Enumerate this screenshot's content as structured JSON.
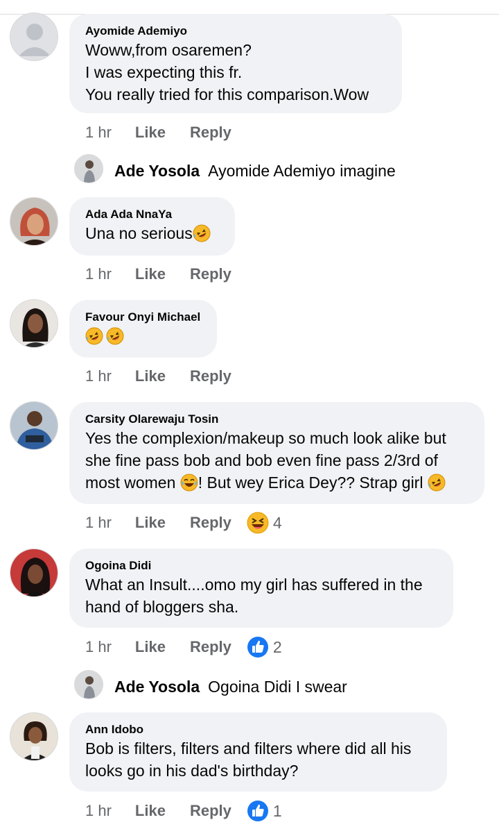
{
  "colors": {
    "bubble": "#f0f2f5",
    "meta": "#65676b",
    "like_blue": "#1877f2",
    "haha_yellow": "#f7b928"
  },
  "comments": [
    {
      "author": "Ayomide Ademiyo",
      "text": "Woww,from osaremen?\nI was expecting this fr.\nYou really tried for this comparison.Wow",
      "time": "1 hr",
      "like": "Like",
      "reply": "Reply",
      "avatar_icon": "default-user-avatar-icon"
    },
    {
      "author": "Ada Ada NnaYa",
      "text": "Una no serious",
      "time": "1 hr",
      "like": "Like",
      "reply": "Reply",
      "avatar_icon": "user-photo-avatar"
    },
    {
      "author": "Favour Onyi Michael",
      "text": "",
      "time": "1 hr",
      "like": "Like",
      "reply": "Reply",
      "avatar_icon": "user-photo-avatar"
    },
    {
      "author": "Carsity Olarewaju Tosin",
      "line1": "Yes the complexion/makeup so much look alike but",
      "line2": "she fine pass bob and bob even fine pass 2/3rd of",
      "line3a": "most women ",
      "line3b": "! But wey Erica Dey?? Strap girl ",
      "time": "1 hr",
      "like": "Like",
      "reply": "Reply",
      "reaction_icon": "haha-reaction-icon",
      "reaction_count": "4"
    },
    {
      "author": "Ogoina Didi",
      "text": "What an Insult....omo my girl has suffered in the\nhand of bloggers sha.",
      "time": "1 hr",
      "like": "Like",
      "reply": "Reply",
      "reaction_icon": "like-reaction-icon",
      "reaction_count": "2"
    },
    {
      "author": "Ann Idobo",
      "text": "Bob is filters, filters and filters where did all his\nlooks go in his dad's birthday?",
      "time": "1 hr",
      "like": "Like",
      "reply": "Reply",
      "reaction_icon": "like-reaction-icon",
      "reaction_count": "1"
    }
  ],
  "replies": [
    {
      "author": "Ade Yosola",
      "text": "Ayomide Ademiyo imagine"
    },
    {
      "author": "Ade Yosola",
      "text": "Ogoina Didi I swear"
    }
  ]
}
